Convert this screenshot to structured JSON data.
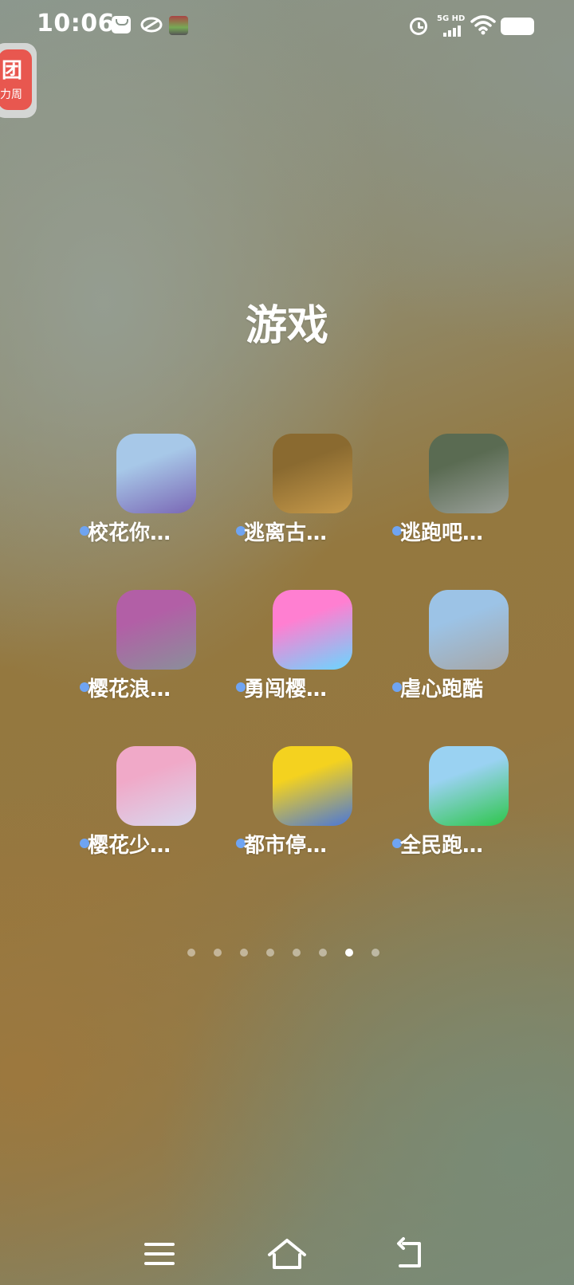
{
  "status_bar": {
    "time": "10:06",
    "network_label": "5G HD",
    "notification_icons": [
      "mail-icon",
      "cloud-link-icon",
      "game-thumbnail-icon"
    ],
    "system_icons": [
      "alarm-icon",
      "signal-icon",
      "wifi-icon",
      "battery-icon"
    ]
  },
  "floating_app": {
    "glyph": "团",
    "label": "力周"
  },
  "folder": {
    "title": "游戏",
    "apps": [
      {
        "label": "校花你…",
        "colors": [
          "#a7c8e8",
          "#7a67b5"
        ]
      },
      {
        "label": "逃离古…",
        "colors": [
          "#8a6a30",
          "#c79a4a"
        ]
      },
      {
        "label": "逃跑吧…",
        "colors": [
          "#5a6b52",
          "#9aa09a"
        ]
      },
      {
        "label": "樱花浪…",
        "colors": [
          "#b25fa6",
          "#8a8f9a"
        ]
      },
      {
        "label": "勇闯樱…",
        "colors": [
          "#ff7fd1",
          "#6ad6ff"
        ]
      },
      {
        "label": "虐心跑酷",
        "colors": [
          "#9cc3e6",
          "#a6a6a6"
        ]
      },
      {
        "label": "樱花少…",
        "colors": [
          "#f0a9c8",
          "#d8d8ee"
        ]
      },
      {
        "label": "都市停…",
        "colors": [
          "#f4d21f",
          "#4a77d8"
        ]
      },
      {
        "label": "全民跑…",
        "colors": [
          "#9ad2f2",
          "#2ec64b"
        ]
      }
    ]
  },
  "pager": {
    "count": 8,
    "active_index": 6
  },
  "nav": {
    "buttons": [
      "menu-icon",
      "home-icon",
      "back-icon"
    ]
  }
}
